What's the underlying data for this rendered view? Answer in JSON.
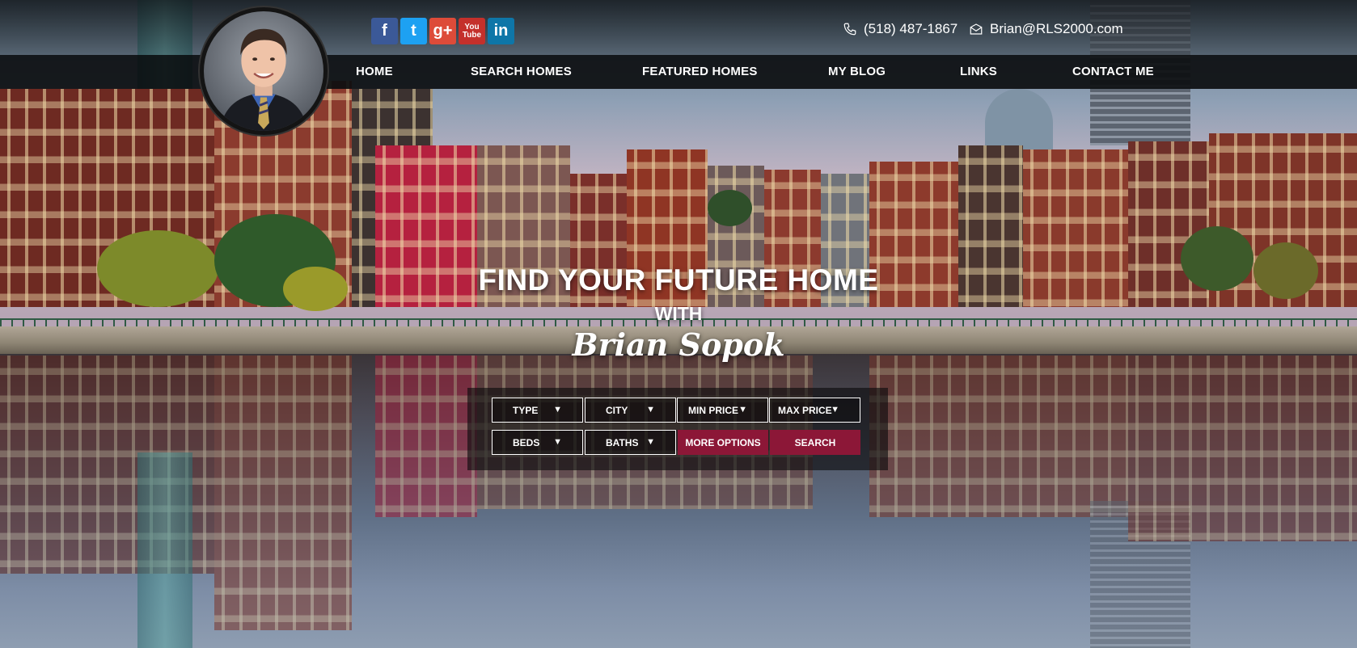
{
  "header": {
    "phone": "(518) 487-1867",
    "email": "Brian@RLS2000.com",
    "social": [
      {
        "icon": "facebook-icon",
        "glyph": "f",
        "color": "#3b5998"
      },
      {
        "icon": "twitter-icon",
        "glyph": "t",
        "color": "#1da1f2"
      },
      {
        "icon": "google-plus-icon",
        "glyph": "g+",
        "color": "#dd4b39"
      },
      {
        "icon": "youtube-icon",
        "glyph": "You Tube",
        "color": "#c4302b"
      },
      {
        "icon": "linkedin-icon",
        "glyph": "in",
        "color": "#0e76a8"
      }
    ]
  },
  "nav": {
    "items": [
      "HOME",
      "SEARCH HOMES",
      "FEATURED HOMES",
      "MY BLOG",
      "LINKS",
      "CONTACT ME"
    ]
  },
  "hero": {
    "title": "FIND YOUR FUTURE HOME",
    "with": "WITH",
    "name": "Brian Sopok"
  },
  "search": {
    "type_label": "TYPE",
    "city_label": "CITY",
    "min_price_label": "MIN PRICE",
    "max_price_label": "MAX PRICE",
    "beds_label": "BEDS",
    "baths_label": "BATHS",
    "more_options_label": "MORE OPTIONS",
    "search_label": "SEARCH",
    "caret": "▼"
  },
  "colors": {
    "accent": "#8c1737",
    "nav_bg": "#0c0e10"
  }
}
